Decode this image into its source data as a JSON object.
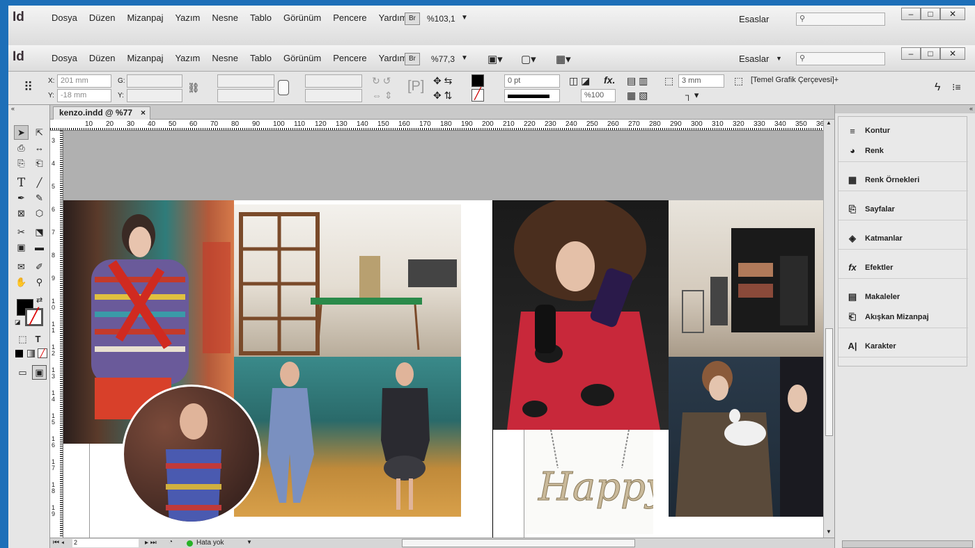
{
  "app": {
    "logo": "Id",
    "menu": [
      "Dosya",
      "Düzen",
      "Mizanpaj",
      "Yazım",
      "Nesne",
      "Tablo",
      "Görünüm",
      "Pencere",
      "Yardım"
    ],
    "bridge": "Br"
  },
  "back_window": {
    "zoom": "%103,1",
    "workspace": "Esaslar"
  },
  "front_window": {
    "zoom": "%77,3",
    "workspace": "Esaslar"
  },
  "control": {
    "x_label": "X:",
    "x_value": "201 mm",
    "y_label": "Y:",
    "y_value": "-18 mm",
    "w_label": "G:",
    "h_label": "Y:",
    "stroke_weight": "0 pt",
    "opacity": "%100",
    "gap": "3 mm",
    "frame_style": "[Temel Grafik Çerçevesi]+"
  },
  "doc_tab": {
    "title": "kenzo.indd @ %77",
    "close": "×"
  },
  "ruler": {
    "marks": [
      "10",
      "20",
      "30",
      "40",
      "50",
      "60",
      "70",
      "80",
      "90",
      "100",
      "110",
      "120",
      "130",
      "140",
      "150",
      "160",
      "170",
      "180",
      "190",
      "200",
      "210",
      "220",
      "230",
      "240",
      "250",
      "260",
      "270",
      "280",
      "290",
      "300",
      "310",
      "320",
      "330",
      "340",
      "350",
      "36"
    ],
    "vmarks": [
      "3",
      "4",
      "5",
      "6",
      "7",
      "8",
      "9",
      "1 0",
      "1 1",
      "1 2",
      "1 3",
      "1 4",
      "1 5",
      "1 6",
      "1 7",
      "1 8",
      "1 9"
    ]
  },
  "panels": [
    {
      "icon": "stroke-icon",
      "label": "Kontur"
    },
    {
      "icon": "color-icon",
      "label": "Renk"
    },
    {
      "icon": "swatches-icon",
      "label": "Renk Örnekleri"
    },
    {
      "icon": "pages-icon",
      "label": "Sayfalar"
    },
    {
      "icon": "layers-icon",
      "label": "Katmanlar"
    },
    {
      "icon": "effects-icon",
      "label": "Efektler"
    },
    {
      "icon": "articles-icon",
      "label": "Makaleler"
    },
    {
      "icon": "liquid-layout-icon",
      "label": "Akışkan Mizanpaj"
    },
    {
      "icon": "character-icon",
      "label": "Karakter"
    }
  ],
  "status": {
    "page": "2",
    "errors": "Hata yok"
  },
  "images": {
    "happy_text": "Happy"
  },
  "colors": {
    "titlebar": "#1d6fb8",
    "pasteboard": "#b0b0b0",
    "panel_bg": "#e6e6e6",
    "error_ok": "#27b227"
  }
}
